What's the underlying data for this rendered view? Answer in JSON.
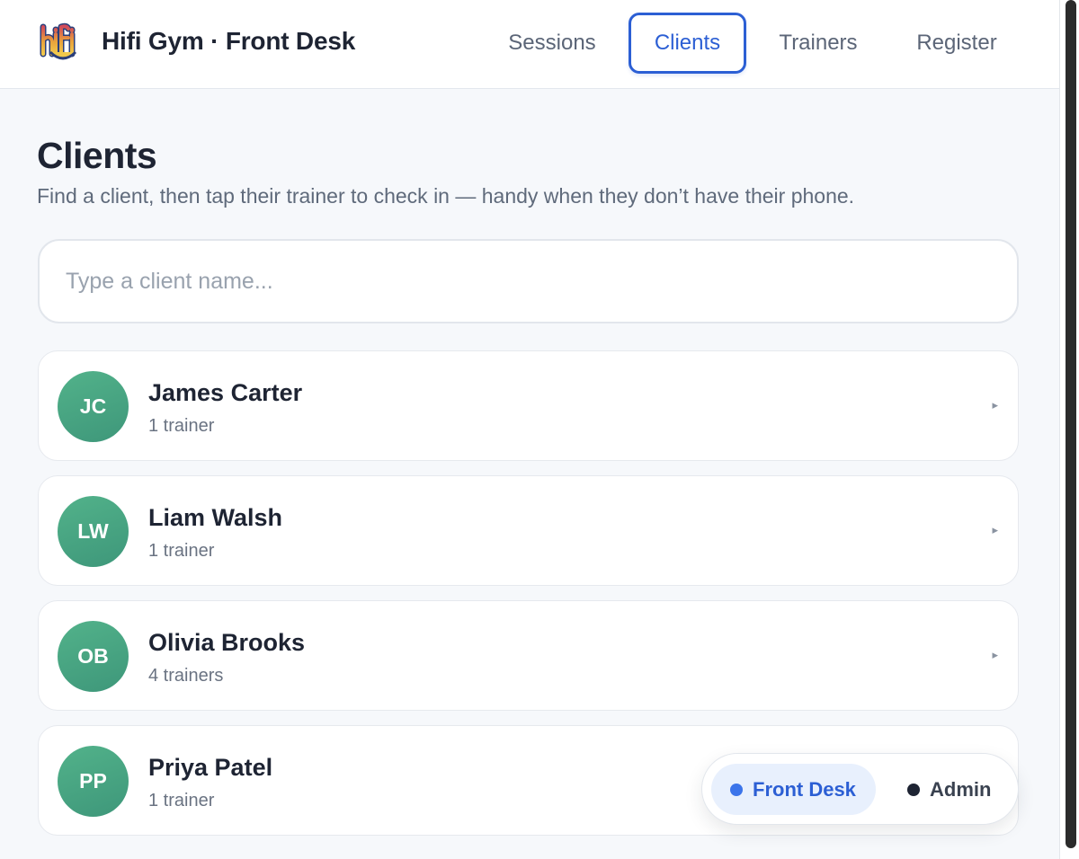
{
  "header": {
    "brand": "Hifi Gym · Front Desk",
    "logo_text": "hifi",
    "nav": [
      {
        "label": "Sessions",
        "active": false
      },
      {
        "label": "Clients",
        "active": true
      },
      {
        "label": "Trainers",
        "active": false
      },
      {
        "label": "Register",
        "active": false
      }
    ]
  },
  "page": {
    "title": "Clients",
    "subtitle": "Find a client, then tap their trainer to check in — handy when they don’t have their phone."
  },
  "search": {
    "value": "",
    "placeholder": "Type a client name..."
  },
  "clients": [
    {
      "initials": "JC",
      "name": "James Carter",
      "meta": "1 trainer",
      "chevron": "▸"
    },
    {
      "initials": "LW",
      "name": "Liam Walsh",
      "meta": "1 trainer",
      "chevron": "▸"
    },
    {
      "initials": "OB",
      "name": "Olivia Brooks",
      "meta": "4 trainers",
      "chevron": "▸"
    },
    {
      "initials": "PP",
      "name": "Priya Patel",
      "meta": "1 trainer",
      "chevron": "▸"
    }
  ],
  "role_switch": {
    "options": [
      {
        "label": "Front Desk",
        "active": true
      },
      {
        "label": "Admin",
        "active": false
      }
    ]
  },
  "colors": {
    "accent": "#2c5fd4",
    "avatar": "#4aa884",
    "page_bg": "#f6f8fb"
  }
}
